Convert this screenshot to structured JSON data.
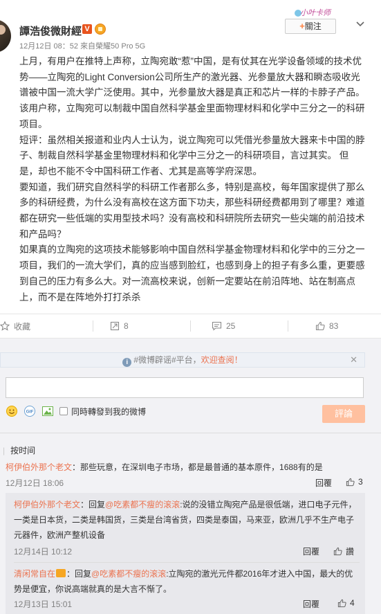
{
  "post": {
    "author": "譚浩俊微財經",
    "vip_badge": "V",
    "time": "12月12日 08：52",
    "source": "來自榮耀50 Pro 5G",
    "follow_plus": "+",
    "follow_label": "關注",
    "decoration_text": "小叶卡师",
    "paragraphs": [
      "上月，有用户在推特上声称，立陶宛敢“惹”中国，是有仗其在光学设备领域的技术优势——立陶宛的Light Conversion公司所生产的激光器、光参量放大器和瞬态吸收光谱被中国一流大学广泛使用。其中，光参量放大器是真正和芯片一样的卡脖子产品。该用户称，立陶宛可以制裁中国自然科学基金里面物理材料和化学中三分之一的科研项目。",
      "短评：虽然相关报道和业内人士认为，说立陶宛可以凭借光参量放大器来卡中国的脖子、制裁自然科学基金里物理材料和化学中三分之一的科研项目，言过其实。   但是，却也不能不令中国科研工作者、尤其是高等学府深思。",
      "要知道，我们研究自然科学的科研工作者那么多，特别是高校，每年国家提供了那么多的科研经费，为什么没有高校在这方面下功夫，那些科研经费都用到了哪里？难道都在研究一些低端的实用型技术吗？没有高校和科研院所去研究一些尖端的前沿技术和产品吗？",
      "如果真的立陶宛的这项技术能够影响中国自然科学基金物理材料和化学中的三分之一项目，我们的一流大学们，真的应当感到脸红，也感到身上的担子有多么重，更要感到自己的压力有多么大。对一流高校来说，创新一定要站在前沿阵地、站在制高点上，而不是在阵地外打打杀杀"
    ]
  },
  "actions": {
    "favorite": "收藏",
    "repost": "8",
    "comment": "25",
    "like": "83"
  },
  "comments_area": {
    "notice_prefix": "#微博辟谣#平台，",
    "notice_highlight": "欢迎查阅！",
    "notice_icon": "i",
    "notice_close": "✕",
    "repost_label": "同時轉發到我的微博",
    "submit_label": "評論",
    "sort_label": "按时间",
    "gif_label": "GIF",
    "comments": [
      {
        "user": "柯伊伯外那个老文",
        "text": "：那些玩意，在深圳电子市场，都是最普通的基本原件，1688有的是",
        "time": "12月12日 18:06",
        "reply_label": "回覆",
        "likes": "3",
        "replies": [
          {
            "user": "柯伊伯外那个老文",
            "text_prefix": "：回复",
            "mention": "@吃素都不瘦的滚滚",
            "text": ":说的没错立陶宛产品是很低端，进口电子元件，一类是日本货，二类是韩国货，三类是台湾省货，四类是泰国，马来亚，欧洲几乎不生产电子元器件，欧洲产整机设备",
            "time": "12月14日 10:12",
            "reply_label": "回覆",
            "likes": "讚"
          },
          {
            "user": "清闲常自在",
            "text_prefix": "：回复",
            "mention": "@吃素都不瘦的滚滚",
            "text": ":立陶宛的激光元件都2016年才进入中国，最大的优势是便宜，你说高端就真的是大言不惭了。",
            "time": "12月13日 15:01",
            "reply_label": "回覆",
            "likes": "4"
          }
        ]
      }
    ]
  },
  "colors": {
    "link": "#eb7350",
    "submit_bg": "#ffc09f",
    "meta_gray": "#808080"
  },
  "icons": [
    "star-icon",
    "repost-icon",
    "comment-icon",
    "thumbs-up-icon",
    "info-icon",
    "chevron-down-icon",
    "emoji-icon",
    "gif-icon",
    "image-icon"
  ]
}
